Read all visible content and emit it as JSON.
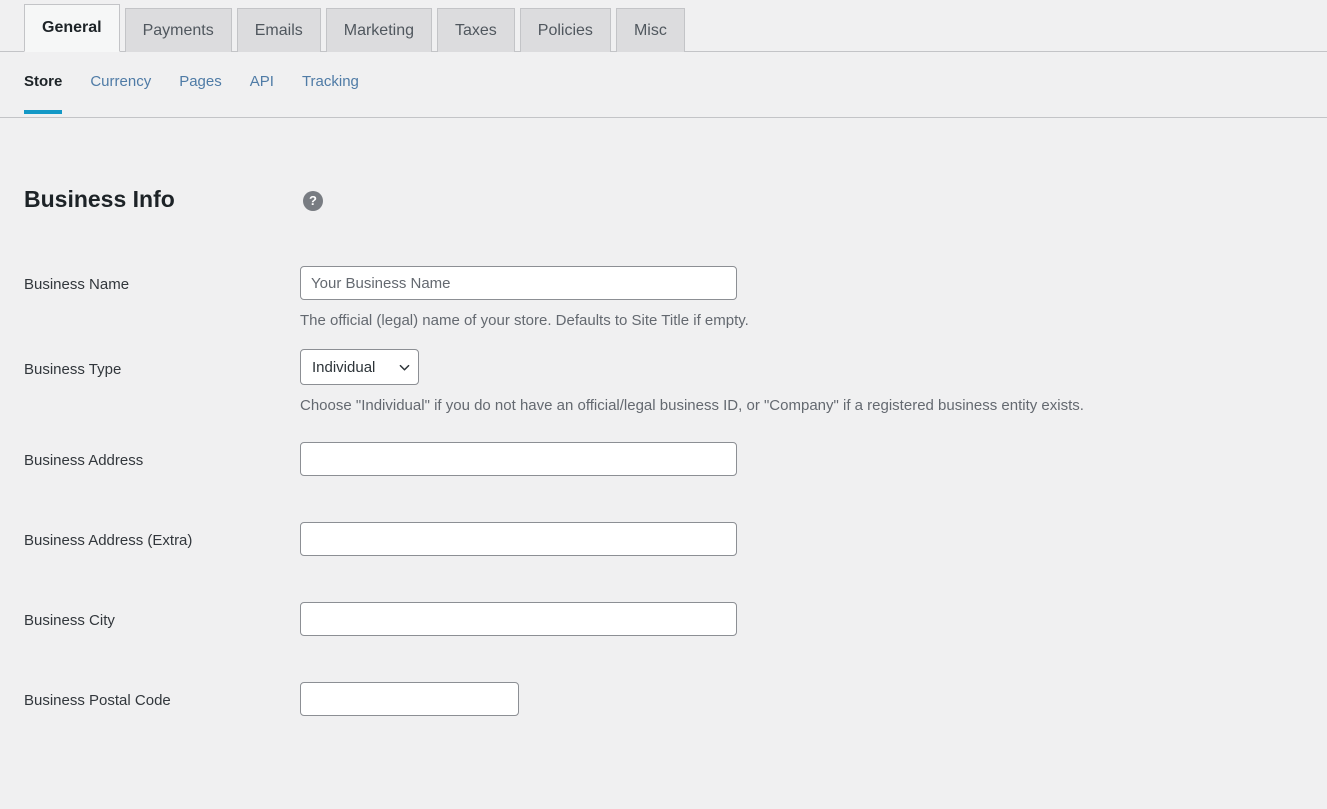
{
  "tabs": [
    {
      "label": "General",
      "active": true
    },
    {
      "label": "Payments",
      "active": false
    },
    {
      "label": "Emails",
      "active": false
    },
    {
      "label": "Marketing",
      "active": false
    },
    {
      "label": "Taxes",
      "active": false
    },
    {
      "label": "Policies",
      "active": false
    },
    {
      "label": "Misc",
      "active": false
    }
  ],
  "subnav": [
    {
      "label": "Store",
      "active": true
    },
    {
      "label": "Currency",
      "active": false
    },
    {
      "label": "Pages",
      "active": false
    },
    {
      "label": "API",
      "active": false
    },
    {
      "label": "Tracking",
      "active": false
    }
  ],
  "section": {
    "title": "Business Info",
    "help_glyph": "?"
  },
  "fields": {
    "business_name": {
      "label": "Business Name",
      "value": "",
      "placeholder": "Your Business Name",
      "description": "The official (legal) name of your store. Defaults to Site Title if empty."
    },
    "business_type": {
      "label": "Business Type",
      "selected": "Individual",
      "description": "Choose \"Individual\" if you do not have an official/legal business ID, or \"Company\" if a registered business entity exists."
    },
    "business_address": {
      "label": "Business Address",
      "value": "",
      "placeholder": ""
    },
    "business_address_extra": {
      "label": "Business Address (Extra)",
      "value": "",
      "placeholder": ""
    },
    "business_city": {
      "label": "Business City",
      "value": "",
      "placeholder": ""
    },
    "business_postal_code": {
      "label": "Business Postal Code",
      "value": "",
      "placeholder": ""
    }
  },
  "colors": {
    "page_background": "#f0f0f1",
    "active_underline": "#1398c6",
    "link": "#4f7ba6",
    "input_border": "#8c8f94",
    "help_icon_background": "#787c82",
    "text": "#32373c",
    "muted_text": "#646970"
  }
}
